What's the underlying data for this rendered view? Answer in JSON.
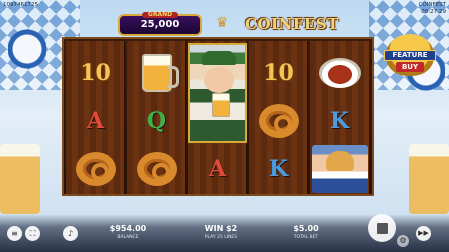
{
  "status_bar": {
    "left_line1": "1097461725",
    "left_line2": "",
    "right_line1": "COINFEST",
    "right_line2": "09:27:29"
  },
  "header": {
    "grand_label": "GRAND",
    "grand_value": "25,000",
    "logo_text": "COINFEST"
  },
  "reels": [
    [
      "10",
      "A",
      "pretzel"
    ],
    [
      "beer-mug",
      "Q",
      "pretzel"
    ],
    [
      "wild"
    ],
    [
      "10",
      "pretzel",
      "K"
    ],
    [
      "sausages",
      "K",
      "barmaid"
    ]
  ],
  "symbols": {
    "r0c0": "10",
    "r1c0": "A",
    "r0c1": "Q",
    "r2c2": "A",
    "r0c3": "10",
    "r2c3": "K",
    "r1c4": "K"
  },
  "feature_buy": {
    "line1": "FEATURE",
    "line2": "BUY"
  },
  "bottom": {
    "balance_value": "$954.00",
    "balance_label": "BALANCE",
    "win_value": "WIN $2",
    "win_label": "PLAY 25 LINES",
    "bet_value": "$5.00",
    "bet_label": "TOTAL BET"
  },
  "icons": {
    "menu": "menu-icon",
    "fullscreen": "fullscreen-icon",
    "sound": "speaker-icon",
    "spin": "stop-icon",
    "settings": "gear-icon",
    "turbo": "fast-forward-icon"
  },
  "colors": {
    "gold": "#f3c457",
    "letter_a": "#e24a3a",
    "letter_q": "#3fb14b",
    "letter_k": "#4b9be0",
    "frame": "#7a4a1c"
  }
}
